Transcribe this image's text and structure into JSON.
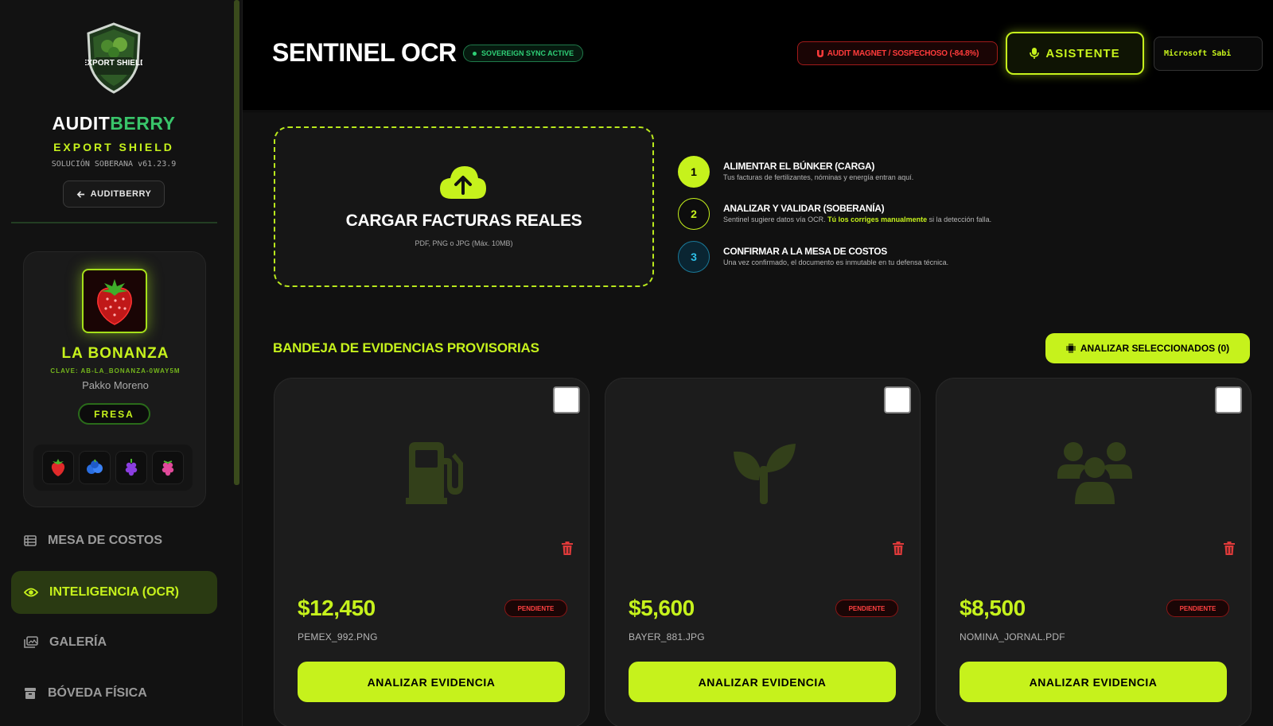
{
  "brand": {
    "name_part1": "AUDIT",
    "name_part2": "BERRY",
    "subtitle": "EXPORT SHIELD",
    "version": "SOLUCIÓN SOBERANA v61.23.9",
    "back_label": "AUDITBERRY",
    "logo_text": "EXPORT SHIELD"
  },
  "profile": {
    "farm_name": "LA BONANZA",
    "key": "CLAVE: AB-LA_BONANZA-0WAY5M",
    "owner": "Pakko Moreno",
    "crop": "FRESA",
    "crops": [
      "strawberry-icon",
      "blueberry-icon",
      "blackberry-icon",
      "raspberry-icon"
    ]
  },
  "nav": {
    "items": [
      {
        "label": "MESA DE COSTOS",
        "icon": "table-icon"
      },
      {
        "label": "INTELIGENCIA (OCR)",
        "icon": "eye-icon",
        "active": true
      },
      {
        "label": "GALERÍA",
        "icon": "gallery-icon"
      },
      {
        "label": "BÓVEDA FÍSICA",
        "icon": "archive-icon"
      }
    ]
  },
  "header": {
    "title": "SENTINEL OCR",
    "sync_badge": "SOVEREIGN SYNC ACTIVE",
    "audit_badge": "AUDIT MAGNET / SOSPECHOSO (-84.8%)",
    "assistant_label": "ASISTENTE",
    "voice": "Microsoft Sabi"
  },
  "upload": {
    "title": "CARGAR FACTURAS REALES",
    "hint": "PDF, PNG o JPG (Máx. 10MB)"
  },
  "steps": [
    {
      "num": "1",
      "title": "ALIMENTAR EL BÚNKER (CARGA)",
      "desc": "Tus facturas de fertilizantes, nóminas y energía entran aquí."
    },
    {
      "num": "2",
      "title": "ANALIZAR Y VALIDAR (SOBERANÍA)",
      "desc_pre": "Sentinel sugiere datos vía OCR. ",
      "desc_hl": "Tú los corriges manualmente",
      "desc_post": " si la detección falla."
    },
    {
      "num": "3",
      "title": "CONFIRMAR A LA MESA DE COSTOS",
      "desc": "Una vez confirmado, el documento es inmutable en tu defensa técnica."
    }
  ],
  "tray": {
    "title": "BANDEJA DE EVIDENCIAS PROVISORIAS",
    "analyze_selected": "ANALIZAR SELECCIONADOS (0)"
  },
  "cards": [
    {
      "amount": "$12,450",
      "status": "PENDIENTE",
      "file": "PEMEX_992.PNG",
      "icon": "fuel-pump-icon",
      "action": "ANALIZAR EVIDENCIA"
    },
    {
      "amount": "$5,600",
      "status": "PENDIENTE",
      "file": "BAYER_881.JPG",
      "icon": "seedling-icon",
      "action": "ANALIZAR EVIDENCIA"
    },
    {
      "amount": "$8,500",
      "status": "PENDIENTE",
      "file": "NOMINA_JORNAL.PDF",
      "icon": "users-icon",
      "action": "ANALIZAR EVIDENCIA"
    }
  ],
  "colors": {
    "accent": "#c6f21c",
    "danger": "#ff3b3b",
    "success": "#2fd077",
    "background": "#050505"
  }
}
